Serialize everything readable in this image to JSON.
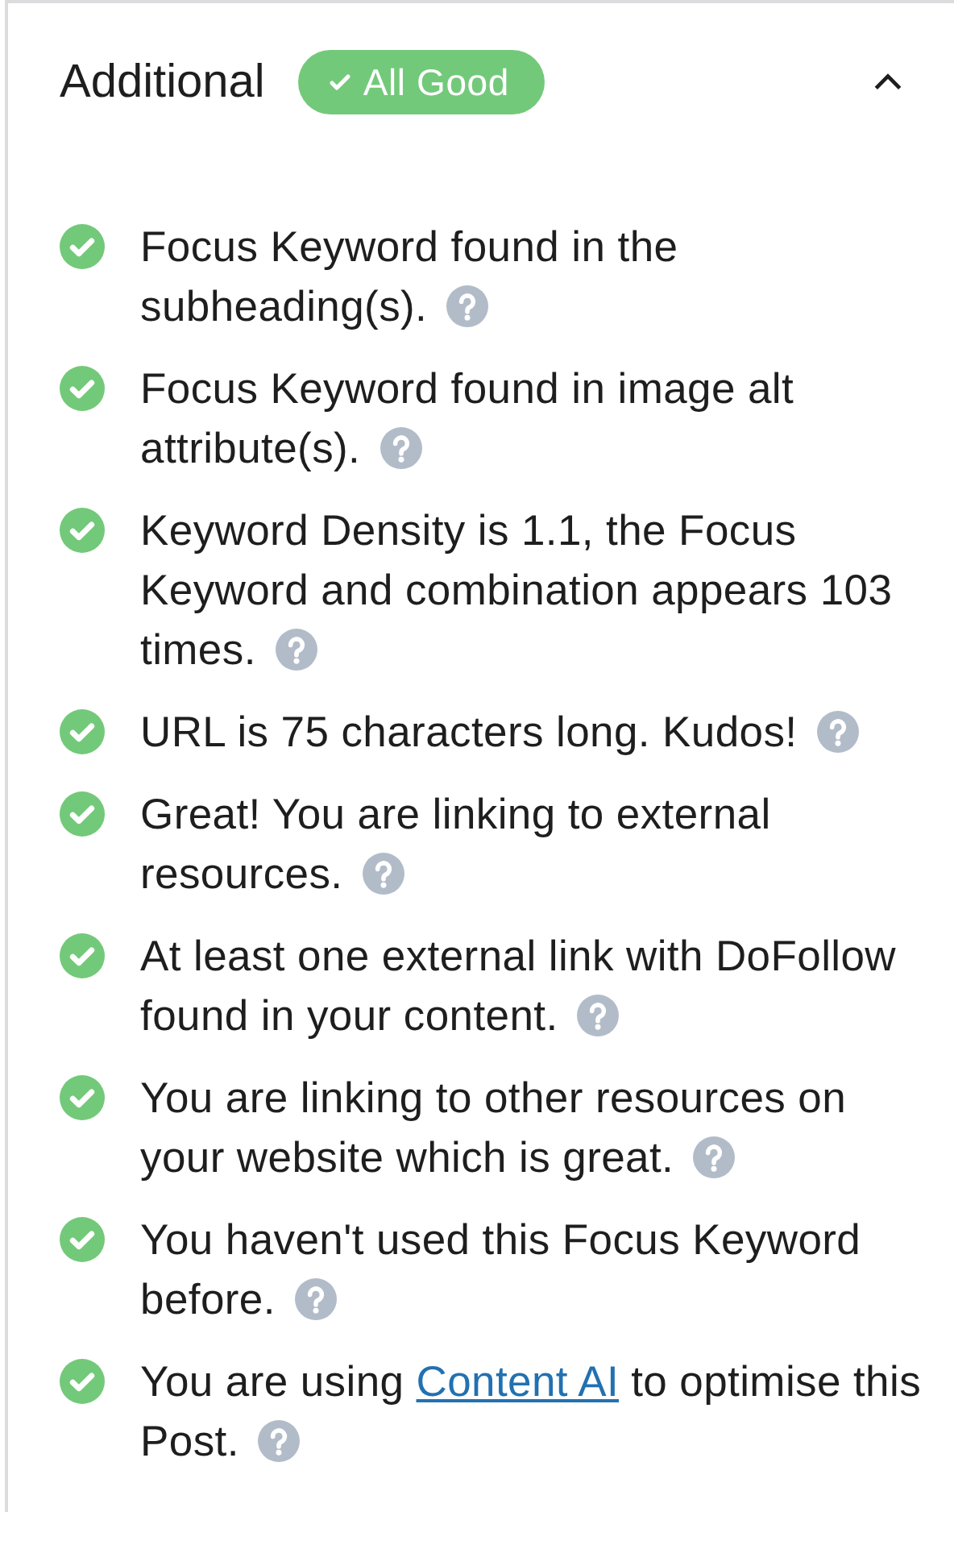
{
  "panel": {
    "title": "Additional",
    "expanded": true,
    "badge": {
      "label": "All Good",
      "kind": "pass"
    }
  },
  "checks": [
    {
      "kind": "pass",
      "text": "Focus Keyword found in the subheading(s)."
    },
    {
      "kind": "pass",
      "text": "Focus Keyword found in image alt attribute(s)."
    },
    {
      "kind": "pass",
      "text": "Keyword Density is 1.1, the Focus Keyword and combination appears 103 times."
    },
    {
      "kind": "pass",
      "text": "URL is 75 characters long. Kudos!"
    },
    {
      "kind": "pass",
      "text": "Great! You are linking to external resources."
    },
    {
      "kind": "pass",
      "text": "At least one external link with DoFollow found in your content."
    },
    {
      "kind": "pass",
      "text": "You are linking to other resources on your website which is great."
    },
    {
      "kind": "pass",
      "text": "You haven't used this Focus Keyword before."
    },
    {
      "kind": "pass",
      "text": "You are using ",
      "link": "Content AI",
      "text_after": " to optimise this Post."
    }
  ]
}
